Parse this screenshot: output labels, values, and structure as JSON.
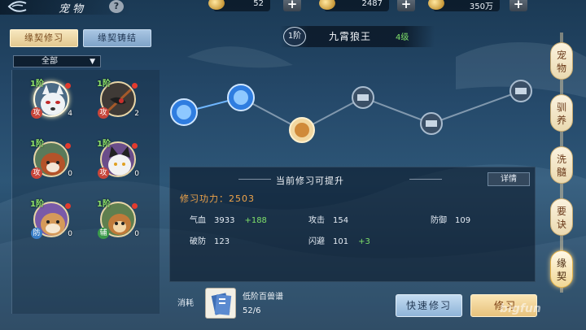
{
  "header": {
    "title": "宠物",
    "help_label": "?"
  },
  "resources": [
    {
      "name": "silver",
      "value": "52"
    },
    {
      "name": "gold",
      "value": "2487"
    },
    {
      "name": "coins",
      "value": "350万"
    }
  ],
  "tabs": {
    "active": "缘契修习",
    "other": "缘契铸结"
  },
  "filter": {
    "selected": "全部"
  },
  "pets": [
    {
      "level": "1阶",
      "badge": "攻",
      "count": "4",
      "badge_color": "#c8453a"
    },
    {
      "level": "1阶",
      "badge": "攻",
      "count": "2",
      "badge_color": "#c8453a"
    },
    {
      "level": "1阶",
      "badge": "攻",
      "count": "0",
      "badge_color": "#c8453a"
    },
    {
      "level": "1阶",
      "badge": "攻",
      "count": "0",
      "badge_color": "#c8453a"
    },
    {
      "level": "1阶",
      "badge": "防",
      "count": "0",
      "badge_color": "#3a7fc8"
    },
    {
      "level": "1阶",
      "badge": "辅",
      "count": "0",
      "badge_color": "#3a9a4a"
    }
  ],
  "selected_pet": {
    "stage": "1阶",
    "name": "九霄狼王",
    "level": "4级"
  },
  "info": {
    "heading": "当前修习可提升",
    "detail_label": "详情",
    "power_label": "修习功力：",
    "power_value": "2503",
    "stats": [
      {
        "label": "气血",
        "value": "3933",
        "bonus": "+188"
      },
      {
        "label": "攻击",
        "value": "154",
        "bonus": ""
      },
      {
        "label": "防御",
        "value": "109",
        "bonus": ""
      },
      {
        "label": "破防",
        "value": "123",
        "bonus": ""
      },
      {
        "label": "闪避",
        "value": "101",
        "bonus": "+3"
      }
    ]
  },
  "cost": {
    "label": "消耗",
    "item_name": "低阶百兽谱",
    "item_count": "52/6"
  },
  "buttons": {
    "quick": "快速修习",
    "train": "修习"
  },
  "right_nav": [
    "宠物",
    "驯养",
    "洗髓",
    "要诀",
    "缘契"
  ],
  "watermark": "bigfun",
  "colors": {
    "green": "#7fe06a",
    "orange": "#f1a54a",
    "accent_gold": "#e2c88f",
    "accent_blue": "#8fb4d8"
  }
}
